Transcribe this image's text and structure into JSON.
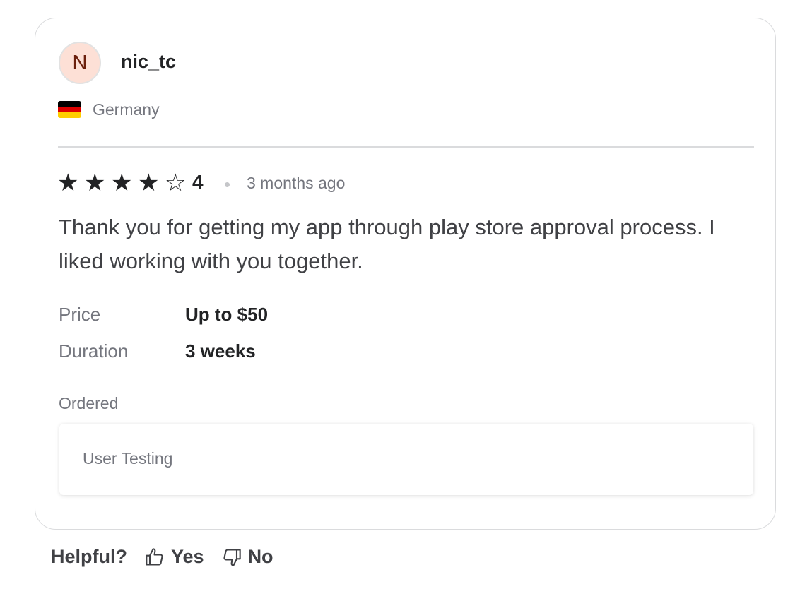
{
  "reviewer": {
    "avatar_initial": "N",
    "username": "nic_tc",
    "country": "Germany",
    "flag_colors": [
      "#000000",
      "#dd0000",
      "#ffce00"
    ]
  },
  "review": {
    "rating": 4,
    "rating_text": "4",
    "max_rating": 5,
    "time_ago": "3 months ago",
    "text": "Thank you for getting my app through play store approval process. I liked working with you together."
  },
  "details": {
    "price_label": "Price",
    "price_value": "Up to $50",
    "duration_label": "Duration",
    "duration_value": "3 weeks"
  },
  "ordered": {
    "label": "Ordered",
    "item": "User Testing"
  },
  "feedback": {
    "question": "Helpful?",
    "yes_label": "Yes",
    "no_label": "No",
    "yes_icon": "thumbs-up-icon",
    "no_icon": "thumbs-down-icon"
  }
}
